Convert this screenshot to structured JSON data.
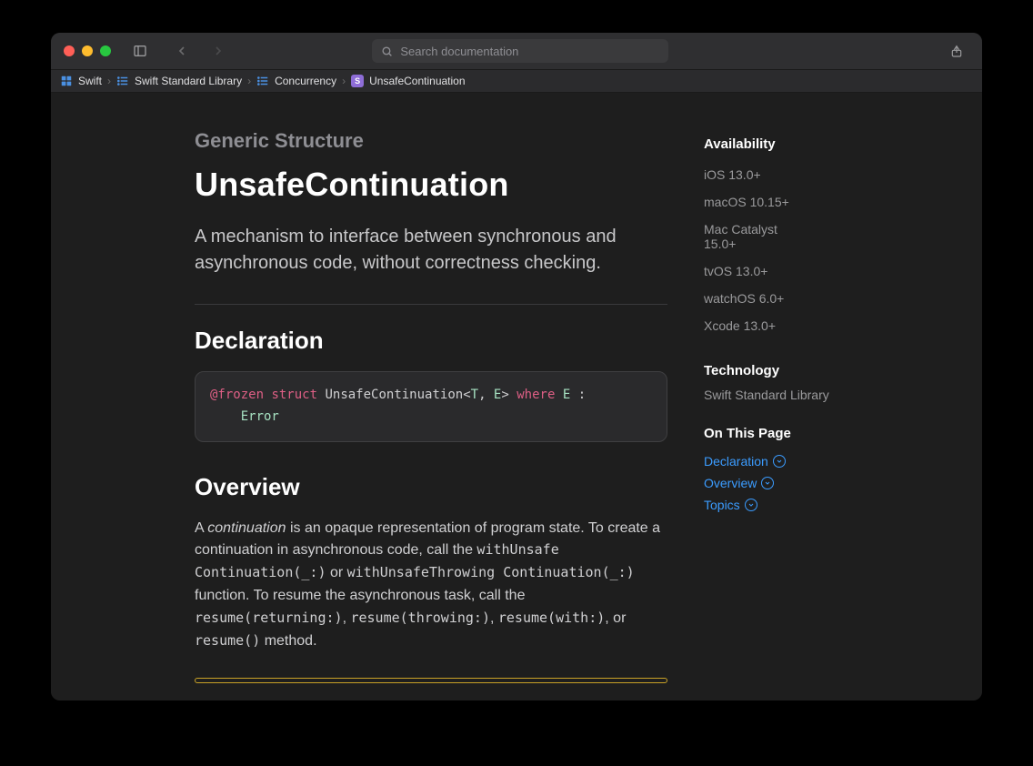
{
  "search": {
    "placeholder": "Search documentation"
  },
  "breadcrumbs": [
    {
      "label": "Swift"
    },
    {
      "label": "Swift Standard Library"
    },
    {
      "label": "Concurrency"
    },
    {
      "label": "UnsafeContinuation"
    }
  ],
  "page": {
    "eyebrow": "Generic Structure",
    "title": "UnsafeContinuation",
    "summary": "A mechanism to interface between synchronous and asynchronous code, without correctness checking.",
    "declaration_heading": "Declaration",
    "overview_heading": "Overview"
  },
  "declaration": {
    "attr": "@frozen",
    "kw1": "struct",
    "name": "UnsafeContinuation",
    "lt": "<",
    "t1": "T",
    "comma": ", ",
    "t2": "E",
    "gt": ">",
    "kw2": "where",
    "t3": "E",
    "colon": " :",
    "indent": "    ",
    "t4": "Error"
  },
  "overview": {
    "p1a": "A ",
    "p1_em": "continuation",
    "p1b": " is an opaque representation of program state. To create a continuation in asynchronous code, call the ",
    "code1": "withUnsafe\nContinuation(_:)",
    "p1c": " or ",
    "code2": "withUnsafeThrowing\nContinuation(_:)",
    "p1d": " function. To resume the asynchronous task, call the ",
    "code3": "resume(returning:)",
    "p1e": ", ",
    "code4": "resume(throwing:)",
    "p1f": ", ",
    "code5": "resume(with:)",
    "p1g": ", or ",
    "code6": "resume()",
    "p1h": " method."
  },
  "sidebar": {
    "availability_heading": "Availability",
    "availability": [
      "iOS 13.0+",
      "macOS 10.15+",
      "Mac Catalyst 15.0+",
      "tvOS 13.0+",
      "watchOS 6.0+",
      "Xcode 13.0+"
    ],
    "technology_heading": "Technology",
    "technology": "Swift Standard Library",
    "onthispage_heading": "On This Page",
    "onthispage": [
      "Declaration",
      "Overview",
      "Topics"
    ]
  }
}
